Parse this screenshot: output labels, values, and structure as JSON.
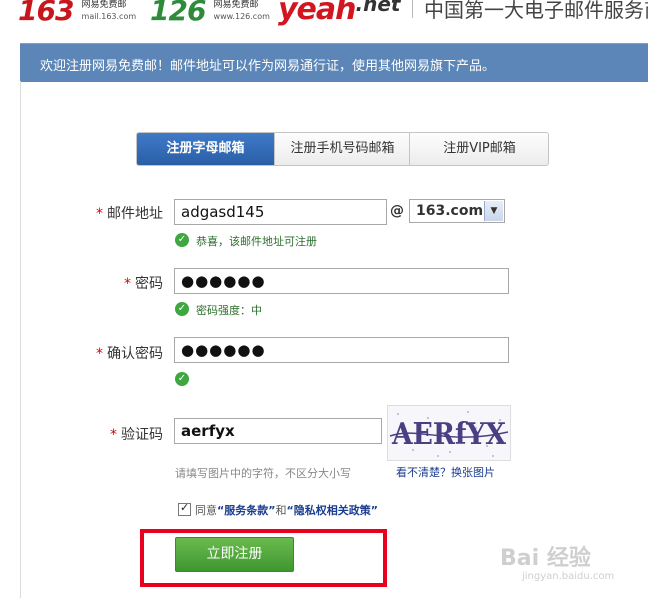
{
  "header": {
    "logo_163": {
      "big": "163",
      "name": "网易免费邮",
      "url": "mail.163.com"
    },
    "logo_126": {
      "big": "126",
      "name": "网易免费邮",
      "url": "www.126.com"
    },
    "logo_yeah": {
      "big": "yeah",
      "suffix": ".net"
    },
    "slogan": "中国第一大电子邮件服务商"
  },
  "banner": {
    "text": "欢迎注册网易免费邮！邮件地址可以作为网易通行证，使用其他网易旗下产品。"
  },
  "tabs": [
    {
      "label": "注册字母邮箱",
      "active": true
    },
    {
      "label": "注册手机号码邮箱",
      "active": false
    },
    {
      "label": "注册VIP邮箱",
      "active": false
    }
  ],
  "form": {
    "email": {
      "required_mark": "*",
      "label": "邮件地址",
      "value": "adgasd145",
      "at": "@",
      "domain": "163.com",
      "hint": "恭喜，该邮件地址可注册"
    },
    "password": {
      "required_mark": "*",
      "label": "密码",
      "value": "●●●●●●",
      "hint": "密码强度：中"
    },
    "confirm": {
      "required_mark": "*",
      "label": "确认密码",
      "value": "●●●●●●"
    },
    "captcha": {
      "required_mark": "*",
      "label": "验证码",
      "value": "aerfyx",
      "hint": "请填写图片中的字符，不区分大小写",
      "refresh": "看不清楚？换张图片",
      "image_text": "AERfYX"
    },
    "agree": {
      "prefix": "同意",
      "terms": "“服务条款”",
      "and": "和",
      "privacy": "“隐私权相关政策”"
    },
    "submit_label": "立即注册"
  },
  "watermark": {
    "main": "Bai 经验",
    "sub": "jingyan.baidu.com"
  }
}
